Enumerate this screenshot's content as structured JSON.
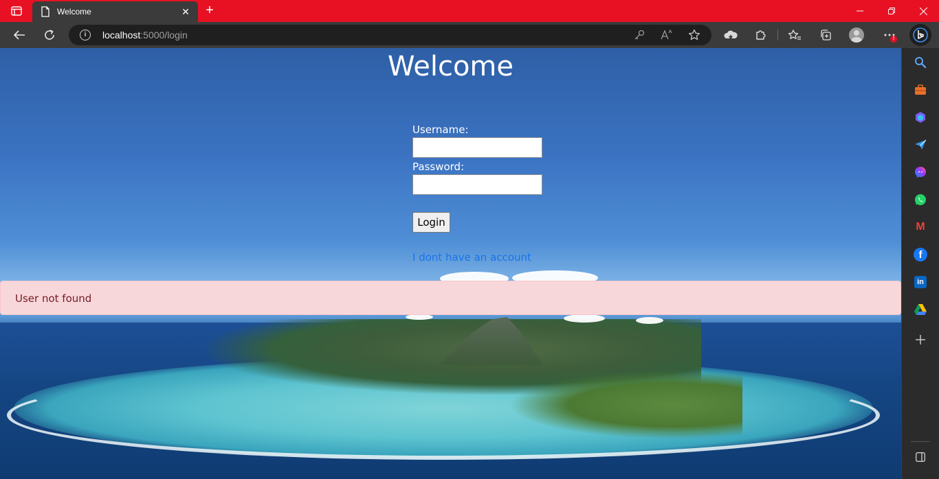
{
  "browser": {
    "tab_title": "Welcome",
    "tab_close": "✕",
    "new_tab": "+",
    "url_host": "localhost",
    "url_path": ":5000/login",
    "notification_badge": "!",
    "colors": {
      "tabbar": "#e81123",
      "toolbar": "#3b3b3b",
      "omnibox": "#1f1f1f",
      "sidebar": "#2b2b2b"
    }
  },
  "sidebar": {
    "icons": [
      "search-icon",
      "tools-icon",
      "copilot-icon",
      "send-icon",
      "messenger-icon",
      "whatsapp-icon",
      "gmail-icon",
      "facebook-icon",
      "linkedin-icon",
      "drive-icon",
      "add-icon",
      "sidebar-panel-icon"
    ],
    "letters": {
      "gmail": "M",
      "facebook": "f",
      "linkedin": "in"
    }
  },
  "page": {
    "title": "Welcome",
    "username_label": "Username:",
    "username_value": "",
    "password_label": "Password:",
    "password_value": "",
    "login_button": "Login",
    "signup_link": "I dont have an account",
    "alert_message": "User not found",
    "colors": {
      "alert_bg": "#f8d7da",
      "alert_text": "#721c24",
      "link": "#1a73e8"
    }
  }
}
